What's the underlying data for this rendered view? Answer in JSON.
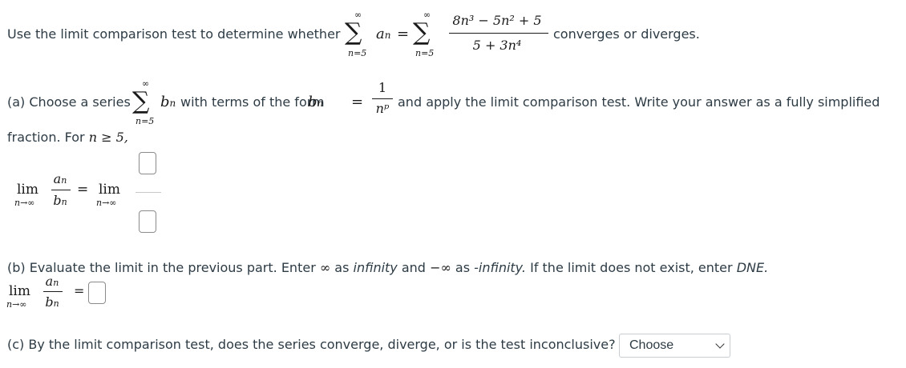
{
  "intro": {
    "prefix": "Use the limit comparison test to determine whether",
    "suffix": "converges or diverges.",
    "sum_upper": "∞",
    "sum_lower": "n=5",
    "term_a": "a",
    "term_a_sub": "n",
    "equals": "=",
    "numerator": "8n³ − 5n² + 5",
    "denominator": "5 + 3n⁴"
  },
  "part_a": {
    "prefix": "(a) Choose a series",
    "sum_upper": "∞",
    "sum_lower": "n=5",
    "term_b": "b",
    "term_b_sub": "n",
    "middle": "with terms of the form",
    "frac_num": "1",
    "frac_den": "nᵖ",
    "suffix": "and apply the limit comparison test. Write your answer as a fully simplified",
    "line2": "fraction. For",
    "condition": "n ≥ 5,",
    "lim_word": "lim",
    "lim_sub": "n→∞",
    "ratio_num": "a",
    "ratio_den": "b",
    "ratio_sub": "n",
    "equals": "=",
    "numerator_input": "",
    "denominator_input": ""
  },
  "part_b": {
    "text_prefix": "(b) Evaluate the limit in the previous part. Enter",
    "inf_symbol": "∞",
    "as1": "as",
    "inf_word": "infinity",
    "and": "and",
    "neg_inf_symbol": "−∞",
    "as2": "as",
    "neg_inf_word": "-infinity.",
    "dne_text": "If the limit does not exist, enter",
    "dne_word": "DNE.",
    "lim_word": "lim",
    "lim_sub": "n→∞",
    "equals": "=",
    "answer_input": ""
  },
  "part_c": {
    "question": "(c) By the limit comparison test, does the series converge, diverge, or is the test inconclusive?",
    "select_value": "Choose"
  }
}
